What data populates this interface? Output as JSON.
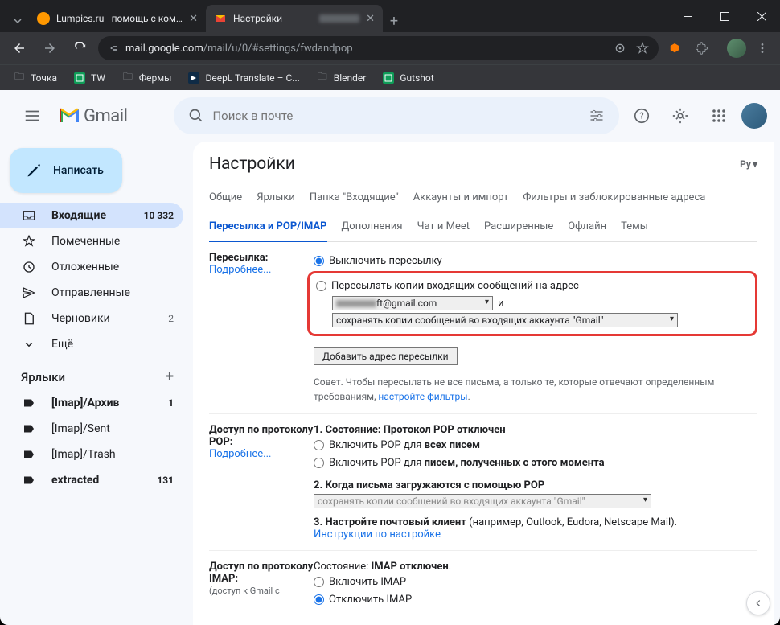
{
  "browser": {
    "tabs": [
      {
        "title": "Lumpics.ru - помощь с компь",
        "fav_color": "#ff9800"
      },
      {
        "title": "Настройки - ",
        "fav_color": "#ea4335"
      }
    ],
    "url_prefix": "mail.google.com",
    "url_path": "/mail/u/0/#settings/fwdandpop",
    "bookmarks": [
      {
        "label": "Точка",
        "type": "folder"
      },
      {
        "label": "TW",
        "type": "sheet"
      },
      {
        "label": "Фермы",
        "type": "folder"
      },
      {
        "label": "DeepL Translate – С...",
        "type": "deepl"
      },
      {
        "label": "Blender",
        "type": "folder"
      },
      {
        "label": "Gutshot",
        "type": "sheet"
      }
    ]
  },
  "gmail": {
    "brand": "Gmail",
    "search_placeholder": "Поиск в почте",
    "compose": "Написать",
    "nav": [
      {
        "icon": "inbox",
        "label": "Входящие",
        "count": "10 332",
        "sel": true
      },
      {
        "icon": "star",
        "label": "Помеченные"
      },
      {
        "icon": "clock",
        "label": "Отложенные"
      },
      {
        "icon": "send",
        "label": "Отправленные"
      },
      {
        "icon": "draft",
        "label": "Черновики",
        "count": "2"
      },
      {
        "icon": "more",
        "label": "Ещё"
      }
    ],
    "labels_header": "Ярлыки",
    "labels": [
      {
        "label": "[Imap]/Архив",
        "count": "1",
        "bold": true
      },
      {
        "label": "[Imap]/Sent"
      },
      {
        "label": "[Imap]/Trash"
      },
      {
        "label": "extracted",
        "count": "131",
        "bold": true
      }
    ]
  },
  "settings": {
    "title": "Настройки",
    "lang": "Ру",
    "tabs_row1": [
      "Общие",
      "Ярлыки",
      "Папка \"Входящие\"",
      "Аккаунты и импорт",
      "Фильтры и заблокированные адреса"
    ],
    "tabs_row2": [
      "Пересылка и POP/IMAP",
      "Дополнения",
      "Чат и Meet",
      "Расширенные",
      "Офлайн",
      "Темы"
    ],
    "active_tab": "Пересылка и POP/IMAP",
    "fwd": {
      "label": "Пересылка:",
      "more": "Подробнее...",
      "opt_off": "Выключить пересылку",
      "opt_on": "Пересылать копии входящих сообщений на адрес",
      "email": "ft@gmail.com",
      "and": "и",
      "action": "сохранять копии сообщений во входящих аккаунта \"Gmail\"",
      "add_btn": "Добавить адрес пересылки",
      "tip_pre": "Совет. Чтобы пересылать не все письма, а только те, которые отвечают определенным требованиям, ",
      "tip_link": "настройте фильтры",
      "tip_post": "."
    },
    "pop": {
      "label": "Доступ по протоколу POP:",
      "more": "Подробнее...",
      "h1": "1. Состояние: Протокол POP отключен",
      "opt_all_pre": "Включить POP для ",
      "opt_all_b": "всех писем",
      "opt_now_pre": "Включить POP для ",
      "opt_now_b": "писем, полученных с этого момента",
      "h2": "2. Когда письма загружаются с помощью POP",
      "sel": "сохранять копии сообщений во входящих аккаунта \"Gmail\"",
      "h3_pre": "3. Настройте почтовый клиент ",
      "h3_post": "(например, Outlook, Eudora, Netscape Mail).",
      "instr": "Инструкции по настройке"
    },
    "imap": {
      "label": "Доступ по протоколу IMAP:",
      "note": "(доступ к Gmail с",
      "status_pre": "Состояние: ",
      "status_b": "IMAP отключен",
      "opt_on": "Включить IMAP",
      "opt_off": "Отключить IMAP"
    }
  }
}
